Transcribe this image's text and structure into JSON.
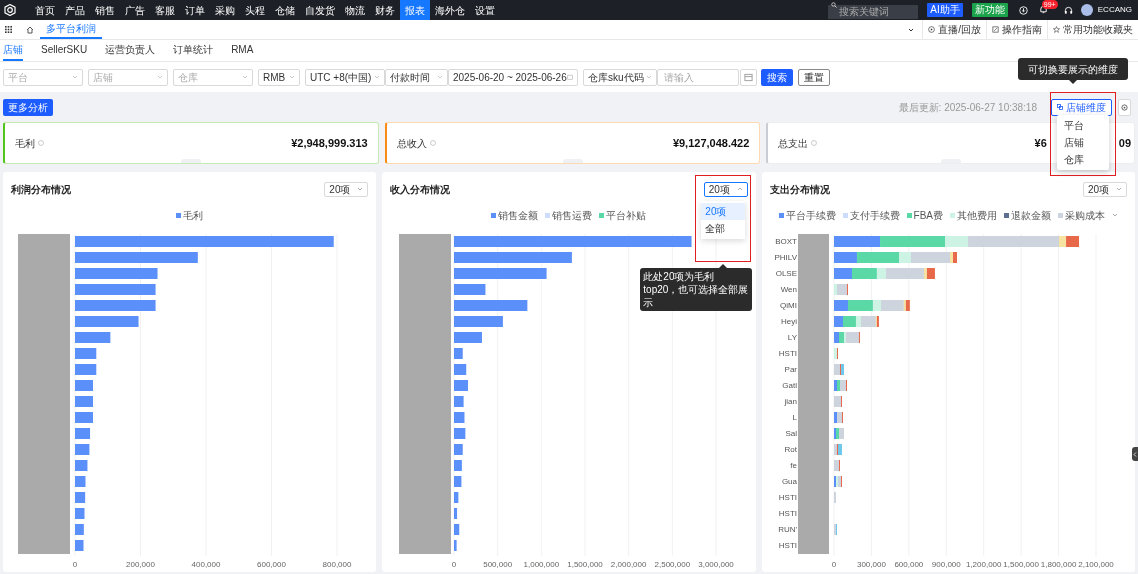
{
  "top_nav": {
    "items": [
      {
        "label": "首页",
        "selected": false
      },
      {
        "label": "产品",
        "selected": false
      },
      {
        "label": "销售",
        "selected": false
      },
      {
        "label": "广告",
        "selected": false
      },
      {
        "label": "客服",
        "selected": false
      },
      {
        "label": "订单",
        "selected": false
      },
      {
        "label": "采购",
        "selected": false
      },
      {
        "label": "头程",
        "selected": false
      },
      {
        "label": "仓储",
        "selected": false
      },
      {
        "label": "自发货",
        "selected": false
      },
      {
        "label": "物流",
        "selected": false
      },
      {
        "label": "财务",
        "selected": false
      },
      {
        "label": "报表",
        "selected": true
      },
      {
        "label": "海外仓",
        "selected": false
      },
      {
        "label": "设置",
        "selected": false
      }
    ],
    "search": {
      "placeholder": "搜索关键词"
    },
    "ai_button": "AI助手",
    "new_button": "新功能",
    "notification_badge": "99+",
    "user": "ECCANG"
  },
  "page_tabs": {
    "items": [
      {
        "label": "多平台利润",
        "selected": true
      }
    ],
    "links": [
      "直播/回放",
      "操作指南",
      "常用功能收藏夹"
    ]
  },
  "sub_tabs": [
    {
      "label": "店铺",
      "selected": true
    },
    {
      "label": "SellerSKU",
      "selected": false
    },
    {
      "label": "运营负责人",
      "selected": false
    },
    {
      "label": "订单统计",
      "selected": false
    },
    {
      "label": "RMA",
      "selected": false
    }
  ],
  "filters": [
    {
      "kind": "select",
      "placeholder": "平台"
    },
    {
      "kind": "select",
      "placeholder": "店铺"
    },
    {
      "kind": "select",
      "placeholder": "仓库"
    },
    {
      "kind": "select",
      "value": "RMB"
    },
    {
      "kind": "select",
      "value": "UTC +8(中国)"
    },
    {
      "kind": "select",
      "value": "付款时间"
    },
    {
      "kind": "date_range",
      "value": "2025-06-20 ~ 2025-06-26"
    },
    {
      "kind": "select",
      "value": "仓库sku代码"
    },
    {
      "kind": "input",
      "placeholder": "请输入"
    }
  ],
  "search_button": "搜索",
  "reset_button": "重置",
  "toolbar": {
    "more_button": "更多分析",
    "last_updated": "最后更新: 2025-06-27 10:38:18",
    "dimension_button": "店铺维度",
    "dimension_menu": [
      {
        "label": "平台",
        "selected": false
      },
      {
        "label": "店铺",
        "selected": false
      },
      {
        "label": "仓库",
        "selected": false
      }
    ]
  },
  "kpis": [
    {
      "label": "毛利",
      "value": "¥2,948,999.313",
      "color": "#52c41a"
    },
    {
      "label": "总收入",
      "value": "¥9,127,048.422",
      "color": "#fa8c16"
    },
    {
      "label": "总支出",
      "value": "¥6",
      "value_tail": "09",
      "color": "#c9ccd3"
    }
  ],
  "charts": [
    {
      "title": "利润分布情况",
      "select": {
        "value": "20项"
      },
      "chart_data": {
        "type": "bar",
        "orientation": "horizontal",
        "grid": true,
        "xlim": [
          0,
          800000
        ],
        "xticks": [
          {
            "value": 0,
            "label": "0"
          },
          {
            "value": 200000,
            "label": "200,000"
          },
          {
            "value": 400000,
            "label": "400,000"
          },
          {
            "value": 600000,
            "label": "600,000"
          },
          {
            "value": 800000,
            "label": "800,000"
          }
        ],
        "series": [
          {
            "name": "毛利",
            "color": "#5b8ff9",
            "values": [
              790000,
              375000,
              252000,
              246000,
              246000,
              194000,
              108000,
              65000,
              65000,
              55000,
              55000,
              55000,
              46000,
              44000,
              38000,
              32000,
              31000,
              29000,
              27000,
              26000
            ]
          }
        ]
      }
    },
    {
      "title": "收入分布情况",
      "select": {
        "value": "20项",
        "options": [
          {
            "label": "20项",
            "selected": true
          },
          {
            "label": "全部",
            "selected": false
          }
        ]
      },
      "chart_data": {
        "type": "bar",
        "orientation": "horizontal",
        "stacked": true,
        "grid": true,
        "xlim": [
          0,
          3000000
        ],
        "xticks": [
          {
            "value": 0,
            "label": "0"
          },
          {
            "value": 500000,
            "label": "500,000"
          },
          {
            "value": 1000000,
            "label": "1,000,000"
          },
          {
            "value": 1500000,
            "label": "1,500,000"
          },
          {
            "value": 2000000,
            "label": "2,000,000"
          },
          {
            "value": 2500000,
            "label": "2,500,000"
          },
          {
            "value": 3000000,
            "label": "3,000,000"
          }
        ],
        "series": [
          {
            "name": "销售金额",
            "color": "#5b8ff9",
            "values": [
              2720000,
              1350000,
              1060000,
              360000,
              840000,
              560000,
              320000,
              100000,
              140000,
              160000,
              110000,
              120000,
              130000,
              100000,
              90000,
              85000,
              50000,
              35000,
              60000,
              30000
            ]
          },
          {
            "name": "销售运费",
            "color": "#cddcfd",
            "values": [
              0,
              0,
              0,
              0,
              0,
              0,
              0,
              0,
              0,
              0,
              0,
              0,
              0,
              0,
              0,
              0,
              0,
              0,
              0,
              0
            ]
          },
          {
            "name": "平台补贴",
            "color": "#5ad8a6",
            "values": [
              0,
              0,
              0,
              0,
              0,
              0,
              0,
              0,
              0,
              0,
              0,
              0,
              0,
              0,
              0,
              0,
              0,
              0,
              0,
              0
            ]
          }
        ]
      }
    },
    {
      "title": "支出分布情况",
      "select": {
        "value": "20项"
      },
      "chart_data": {
        "type": "bar",
        "orientation": "horizontal",
        "stacked": true,
        "grid": true,
        "xlim": [
          0,
          2100000
        ],
        "xticks": [
          {
            "value": 0,
            "label": "0"
          },
          {
            "value": 300000,
            "label": "300,000"
          },
          {
            "value": 600000,
            "label": "600,000"
          },
          {
            "value": 900000,
            "label": "900,000"
          },
          {
            "value": 1200000,
            "label": "1,200,000"
          },
          {
            "value": 1500000,
            "label": "1,500,000"
          },
          {
            "value": 1800000,
            "label": "1,800,000"
          },
          {
            "value": 2100000,
            "label": "2,100,000"
          }
        ],
        "categories": [
          "BOXT",
          "PHILV",
          "OLSE",
          "Wen",
          "QiMI",
          "Heyi",
          "LY",
          "HSTI",
          "Par",
          "Gatl",
          "jian",
          "L",
          "Sal",
          "Rot",
          "fe",
          "Gua",
          "HSTI",
          "HSTI",
          "RUN'",
          "HSTI"
        ],
        "series": [
          {
            "name": "平台手续费",
            "color": "#5b8ff9",
            "values": [
              369000,
              184000,
              144000,
              0,
              112000,
              72000,
              40000,
              0,
              0,
              24000,
              0,
              24000,
              16000,
              0,
              0,
              16000,
              0,
              0,
              0,
              0
            ]
          },
          {
            "name": "支付手续费",
            "color": "#cddcfd",
            "values": [
              0,
              0,
              0,
              0,
              0,
              0,
              0,
              0,
              0,
              0,
              0,
              0,
              0,
              0,
              0,
              0,
              0,
              0,
              0,
              0
            ]
          },
          {
            "name": "FBA费",
            "color": "#5ad8a6",
            "values": [
              521000,
              337000,
              200000,
              0,
              200000,
              104000,
              40000,
              0,
              0,
              24000,
              0,
              0,
              24000,
              0,
              0,
              0,
              0,
              0,
              0,
              0
            ]
          },
          {
            "name": "其他费用",
            "color": "#cdf3e4",
            "values": [
              184000,
              96000,
              72000,
              24000,
              64000,
              40000,
              16000,
              24000,
              0,
              0,
              0,
              0,
              0,
              0,
              0,
              16000,
              0,
              0,
              0,
              0
            ]
          },
          {
            "name": "退款金额",
            "color": "#5d7092",
            "values": [
              0,
              0,
              0,
              0,
              0,
              0,
              0,
              0,
              0,
              0,
              0,
              0,
              0,
              0,
              0,
              0,
              0,
              0,
              0,
              0
            ]
          },
          {
            "name": "采购成本",
            "color": "#ced4de",
            "values": [
              730000,
              313000,
              305000,
              80000,
              184000,
              120000,
              104000,
              0,
              48000,
              48000,
              56000,
              40000,
              40000,
              24000,
              40000,
              24000,
              16000,
              0,
              16000,
              0
            ]
          },
          {
            "color": "#f6e3a1",
            "values": [
              56000,
              24000,
              24000,
              0,
              16000,
              8000,
              0,
              0,
              0,
              0,
              0,
              0,
              0,
              0,
              0,
              0,
              0,
              0,
              0,
              0
            ]
          },
          {
            "color": "#e8684a",
            "values": [
              104000,
              32000,
              64000,
              8000,
              32000,
              16000,
              8000,
              8000,
              8000,
              8000,
              8000,
              8000,
              0,
              8000,
              8000,
              8000,
              0,
              0,
              0,
              0
            ]
          },
          {
            "color": "#6dc8ec",
            "values": [
              0,
              0,
              0,
              0,
              0,
              0,
              0,
              0,
              24000,
              0,
              0,
              0,
              0,
              32000,
              0,
              0,
              0,
              0,
              8000,
              0
            ]
          }
        ]
      }
    }
  ],
  "callouts": [
    {
      "text": "可切换要展示的维度"
    },
    {
      "text": "此处20项为毛利top20，也可选择全部展示"
    }
  ]
}
